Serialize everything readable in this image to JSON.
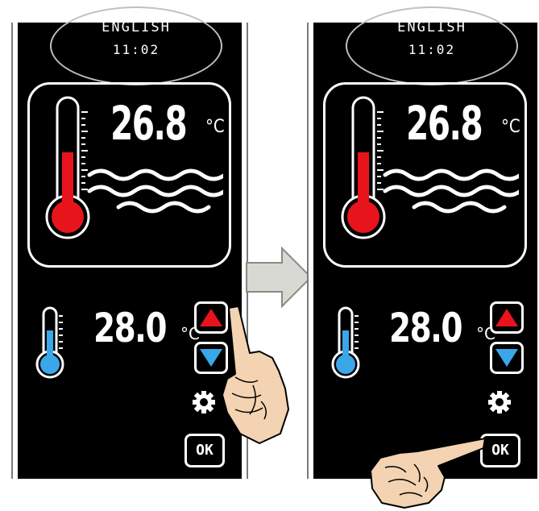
{
  "panels": [
    {
      "language": "ENGLISH",
      "time": "11:02",
      "water_temp": "26.8",
      "water_unit": "°C",
      "set_temp": "28.0",
      "set_unit": "°C",
      "ok_label": "OK"
    },
    {
      "language": "ENGLISH",
      "time": "11:02",
      "water_temp": "26.8",
      "water_unit": "°C",
      "set_temp": "28.0",
      "set_unit": "°C",
      "ok_label": "OK"
    }
  ],
  "colors": {
    "hot": "#e8141c",
    "cold": "#3aa7e8",
    "up_arrow": "#e8141c",
    "down_arrow": "#3aa7e8",
    "arrow_fill": "#d9d9d4"
  },
  "icons": [
    "thermometer-hot-icon",
    "waves-icon",
    "thermometer-cold-icon",
    "up-arrow-icon",
    "down-arrow-icon",
    "gear-icon",
    "pointing-hand-icon",
    "right-arrow-icon"
  ]
}
